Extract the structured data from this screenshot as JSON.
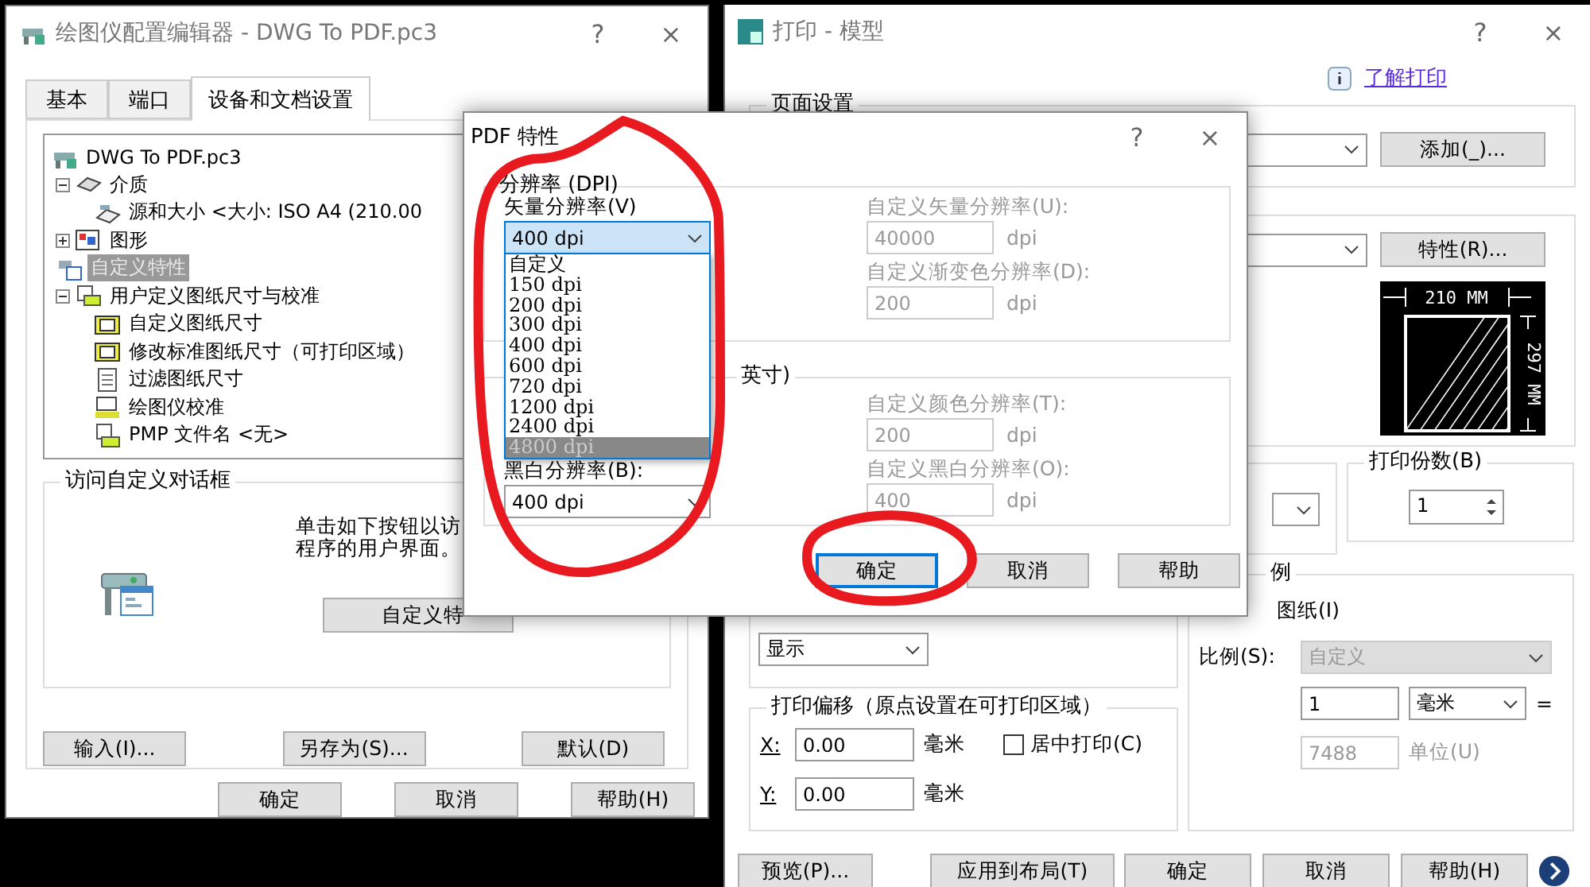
{
  "plotter_editor": {
    "title": "绘图仪配置编辑器 - DWG To PDF.pc3",
    "help": "?",
    "close": "×",
    "tabs": [
      {
        "label": "基本",
        "selected": false
      },
      {
        "label": "端口",
        "selected": false
      },
      {
        "label": "设备和文档设置",
        "selected": true
      }
    ],
    "tree": [
      {
        "label": "DWG To PDF.pc3",
        "kind": "plotter",
        "selected": false,
        "children": [
          {
            "label": "介质",
            "kind": "media",
            "selected": false,
            "expanded": true,
            "children": [
              {
                "label": "源和大小 <大小: ISO A4 (210.00",
                "kind": "paper-source",
                "selected": false
              }
            ]
          },
          {
            "label": "图形",
            "kind": "graphics",
            "selected": false,
            "expanded": false
          },
          {
            "label": "自定义特性",
            "kind": "custom",
            "selected": true
          },
          {
            "label": "用户定义图纸尺寸与校准",
            "kind": "user-paper",
            "selected": false,
            "expanded": true,
            "children": [
              {
                "label": "自定义图纸尺寸",
                "kind": "paper-size",
                "selected": false
              },
              {
                "label": "修改标准图纸尺寸（可打印区域）",
                "kind": "paper-size",
                "selected": false
              },
              {
                "label": "过滤图纸尺寸",
                "kind": "document",
                "selected": false
              },
              {
                "label": "绘图仪校准",
                "kind": "calibrate",
                "selected": false
              },
              {
                "label": "PMP 文件名 <无>",
                "kind": "pmp",
                "selected": false
              }
            ]
          }
        ]
      }
    ],
    "custom_group": {
      "title": "访问自定义对话框",
      "description": "单击如下按钮以访程序的用户界面。",
      "button": "自定义特"
    },
    "file_buttons": [
      "输入(I)...",
      "另存为(S)...",
      "默认(D)"
    ],
    "buttons": [
      "确定",
      "取消",
      "帮助(H)"
    ]
  },
  "print_dialog": {
    "title": "打印 - 模型",
    "help": "?",
    "close": "×",
    "learn_link": "了解打印",
    "page_setup": {
      "title": "页面设置",
      "add_button": "添加(_)..."
    },
    "printer": {
      "properties_button": "特性(R)...",
      "paper_width": "210 MM",
      "paper_height": "297 MM"
    },
    "copies": {
      "title": "打印份数(B)",
      "value": "1"
    },
    "area": {
      "value": "显示"
    },
    "offset": {
      "title": "打印偏移（原点设置在可打印区域）",
      "rows": [
        {
          "label": "X:",
          "value": "0.00",
          "unit": "毫米"
        },
        {
          "label": "Y:",
          "value": "0.00",
          "unit": "毫米"
        }
      ],
      "center": {
        "label": "居中打印(C)",
        "checked": false
      }
    },
    "scale": {
      "title": "例",
      "fit_label": "图纸(I)",
      "scale_label": "比例(S):",
      "scale_value": "自定义",
      "scale_disabled": true,
      "value1": "1",
      "unit": "毫米",
      "equals": "=",
      "value2": "7488",
      "value2_disabled": true,
      "unit2": "单位(U)"
    },
    "buttons": [
      "预览(P)...",
      "应用到布局(T)",
      "确定",
      "取消",
      "帮助(H)"
    ]
  },
  "pdf_dialog": {
    "title": "PDF 特性",
    "help": "?",
    "close": "×",
    "resolution_group": {
      "title": "分辨率 (DPI)",
      "vector_label": "矢量分辨率(V)",
      "vector_value": "400 dpi",
      "vector_options": [
        {
          "label": "自定义",
          "selected": false
        },
        {
          "label": "150 dpi",
          "selected": false
        },
        {
          "label": "200 dpi",
          "selected": false
        },
        {
          "label": "300 dpi",
          "selected": false
        },
        {
          "label": "400 dpi",
          "selected": false
        },
        {
          "label": "600 dpi",
          "selected": false
        },
        {
          "label": "720 dpi",
          "selected": false
        },
        {
          "label": "1200 dpi",
          "selected": false
        },
        {
          "label": "2400 dpi",
          "selected": false
        },
        {
          "label": "4800 dpi",
          "selected": true
        }
      ],
      "custom_fields": [
        {
          "label": "自定义矢量分辨率(U):",
          "value": "40000",
          "unit": "dpi",
          "disabled": true
        },
        {
          "label": "自定义渐变色分辨率(D):",
          "value": "200",
          "unit": "dpi",
          "disabled": true
        }
      ]
    },
    "raster_group": {
      "title": "英寸)",
      "bw_label": "黑白分辨率(B):",
      "bw_value": "400 dpi",
      "custom_fields": [
        {
          "label": "自定义颜色分辨率(T):",
          "value": "200",
          "unit": "dpi",
          "disabled": true
        },
        {
          "label": "自定义黑白分辨率(O):",
          "value": "400",
          "unit": "dpi",
          "disabled": true
        }
      ]
    },
    "buttons": [
      {
        "label": "确定",
        "focused": true
      },
      {
        "label": "取消",
        "focused": false
      },
      {
        "label": "帮助",
        "focused": false
      }
    ]
  }
}
